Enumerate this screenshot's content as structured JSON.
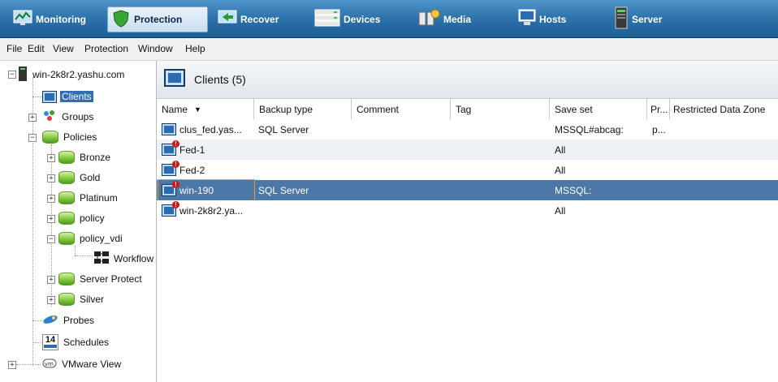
{
  "toolbar": {
    "buttons": [
      {
        "label": "Monitoring",
        "icon": "monitoring-icon"
      },
      {
        "label": "Protection",
        "icon": "shield-icon",
        "active": true
      },
      {
        "label": "Recover",
        "icon": "recover-icon"
      },
      {
        "label": "Devices",
        "icon": "devices-icon"
      },
      {
        "label": "Media",
        "icon": "media-icon"
      },
      {
        "label": "Hosts",
        "icon": "hosts-icon"
      },
      {
        "label": "Server",
        "icon": "server-icon"
      }
    ]
  },
  "menubar": [
    "File",
    "Edit",
    "View",
    "Protection",
    "Window",
    "Help"
  ],
  "tree": {
    "root": "win-2k8r2.yashu.com",
    "clients": "Clients",
    "groups": "Groups",
    "policies": "Policies",
    "policy_items": [
      "Bronze",
      "Gold",
      "Platinum",
      "policy",
      "policy_vdi"
    ],
    "workflow": "Workflow",
    "more_policies": [
      "Server Protect",
      "Silver"
    ],
    "probes": "Probes",
    "schedules": "Schedules",
    "schedules_badge": "14",
    "vmware": "VMware View"
  },
  "panel": {
    "title": "Clients (5)"
  },
  "table": {
    "columns": [
      "Name",
      "Backup type",
      "Comment",
      "Tag",
      "Save set",
      "Pr...",
      "Restricted Data Zone"
    ],
    "rows": [
      {
        "name": "clus_fed.yas...",
        "backup_type": "SQL Server",
        "comment": "",
        "tag": "",
        "save_set": "MSSQL#abcag:",
        "pr": "p...",
        "rdz": "",
        "alert": false
      },
      {
        "name": "Fed-1",
        "backup_type": "",
        "comment": "",
        "tag": "",
        "save_set": "All",
        "pr": "",
        "rdz": "",
        "alert": true
      },
      {
        "name": "Fed-2",
        "backup_type": "",
        "comment": "",
        "tag": "",
        "save_set": "All",
        "pr": "",
        "rdz": "",
        "alert": true
      },
      {
        "name": "win-190",
        "backup_type": "SQL Server",
        "comment": "",
        "tag": "",
        "save_set": "MSSQL:",
        "pr": "",
        "rdz": "",
        "alert": true,
        "selected": true
      },
      {
        "name": "win-2k8r2.ya...",
        "backup_type": "",
        "comment": "",
        "tag": "",
        "save_set": "All",
        "pr": "",
        "rdz": "",
        "alert": true
      }
    ]
  },
  "colors": {
    "toolbar_blue": "#2f74ad",
    "selection_blue": "#4c78a8",
    "alert_red": "#dd1111"
  }
}
